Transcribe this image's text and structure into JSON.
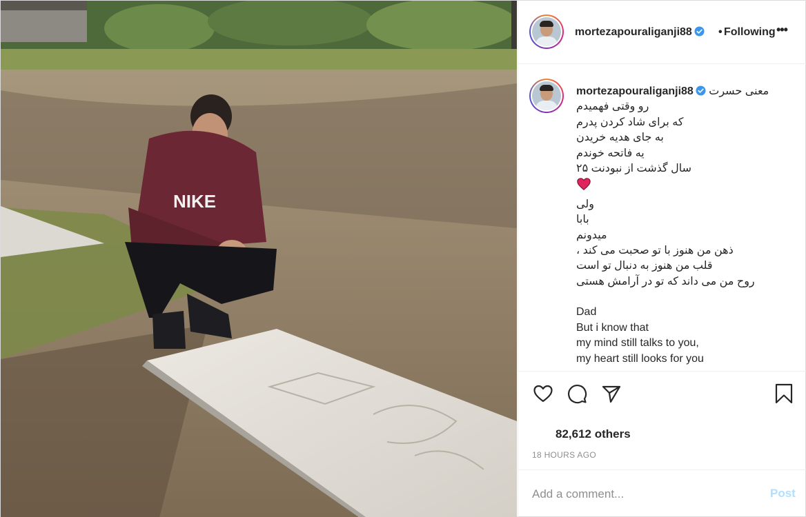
{
  "post": {
    "username": "mortezapouraliganji88",
    "follow_separator": "•",
    "follow_label": "Following",
    "more_label": "•••",
    "caption_lines": [
      "معنی حسرت",
      "رو وقتی فهمیدم",
      "که برای شاد کردن پدرم",
      "به جای هدیه خریدن",
      "یه فاتحه خوندم",
      "۲۵ سال گذشت از نبودنت",
      "",
      "ولی",
      "بابا",
      "میدونم",
      "، ذهن من هنوز با تو صحبت می کند",
      "قلب من هنوز به دنبال تو است",
      "روح من می داند که تو در آرامش هستی",
      "",
      "Dad",
      "But i know that",
      "my mind still talks to you,",
      "my heart still looks for you"
    ],
    "likes_text": "82,612 others",
    "timestamp": "18 HOURS AGO",
    "comment_placeholder": "Add a comment...",
    "post_button": "Post"
  },
  "icons": {
    "verified": "verified-badge-icon",
    "like": "heart-outline-icon",
    "comment": "comment-bubble-icon",
    "share": "paper-plane-icon",
    "save": "bookmark-icon",
    "heart_emoji": "red-heart-emoji"
  },
  "colors": {
    "verified_blue": "#3897f0",
    "post_button_disabled": "#b2dffc",
    "heart_red": "#e0245e",
    "muted_text": "#8e8e8e"
  }
}
